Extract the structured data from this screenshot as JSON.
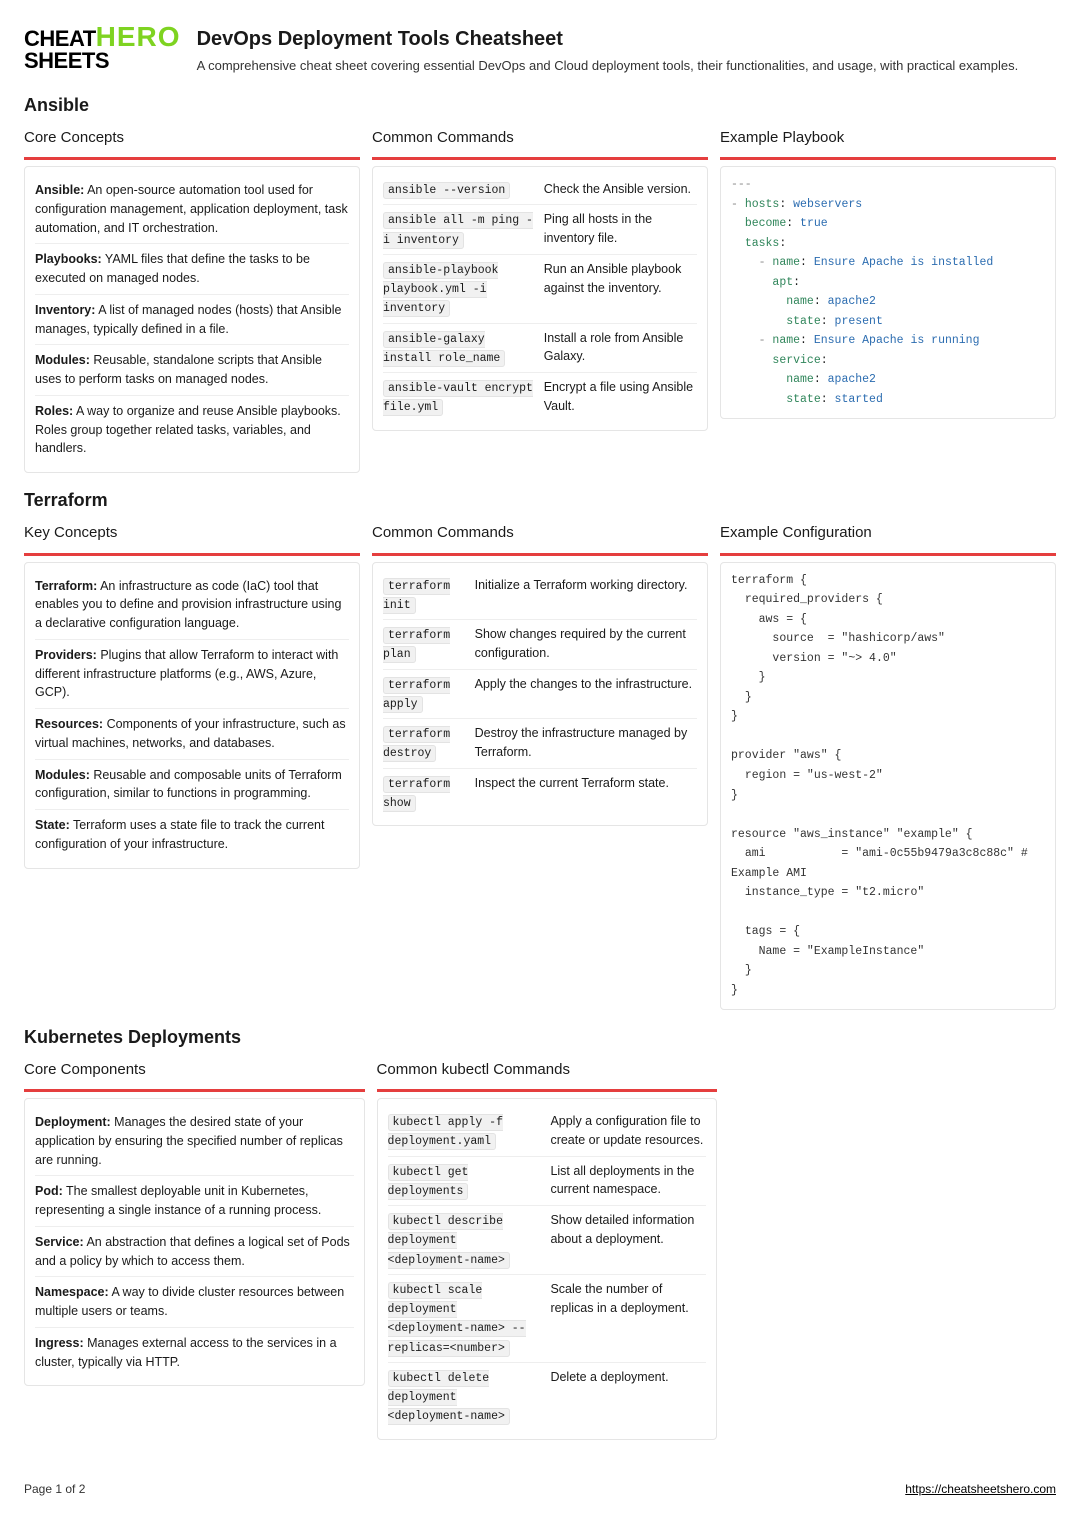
{
  "logo": {
    "line1a": "CHEAT",
    "line1b": "HERO",
    "line2": "SHEETS"
  },
  "title": "DevOps Deployment Tools Cheatsheet",
  "subtitle": "A comprehensive cheat sheet covering essential DevOps and Cloud deployment tools, their functionalities, and usage, with practical examples.",
  "sections": {
    "ansible": {
      "heading": "Ansible",
      "concepts_title": "Core Concepts",
      "concepts": [
        {
          "term": "Ansible:",
          "def": " An open-source automation tool used for configuration management, application deployment, task automation, and IT orchestration."
        },
        {
          "term": "Playbooks:",
          "def": " YAML files that define the tasks to be executed on managed nodes."
        },
        {
          "term": "Inventory:",
          "def": " A list of managed nodes (hosts) that Ansible manages, typically defined in a file."
        },
        {
          "term": "Modules:",
          "def": " Reusable, standalone scripts that Ansible uses to perform tasks on managed nodes."
        },
        {
          "term": "Roles:",
          "def": " A way to organize and reuse Ansible playbooks. Roles group together related tasks, variables, and handlers."
        }
      ],
      "commands_title": "Common Commands",
      "commands": [
        {
          "cmd": "ansible --version",
          "desc": "Check the Ansible version."
        },
        {
          "cmd": "ansible all -m ping -i inventory",
          "desc": "Ping all hosts in the inventory file."
        },
        {
          "cmd": "ansible-playbook playbook.yml -i inventory",
          "desc": "Run an Ansible playbook against the inventory."
        },
        {
          "cmd": "ansible-galaxy install role_name",
          "desc": "Install a role from Ansible Galaxy."
        },
        {
          "cmd": "ansible-vault encrypt file.yml",
          "desc": "Encrypt a file using Ansible Vault."
        }
      ],
      "example_title": "Example Playbook"
    },
    "terraform": {
      "heading": "Terraform",
      "concepts_title": "Key Concepts",
      "concepts": [
        {
          "term": "Terraform:",
          "def": " An infrastructure as code (IaC) tool that enables you to define and provision infrastructure using a declarative configuration language."
        },
        {
          "term": "Providers:",
          "def": " Plugins that allow Terraform to interact with different infrastructure platforms (e.g., AWS, Azure, GCP)."
        },
        {
          "term": "Resources:",
          "def": " Components of your infrastructure, such as virtual machines, networks, and databases."
        },
        {
          "term": "Modules:",
          "def": " Reusable and composable units of Terraform configuration, similar to functions in programming."
        },
        {
          "term": "State:",
          "def": " Terraform uses a state file to track the current configuration of your infrastructure."
        }
      ],
      "commands_title": "Common Commands",
      "commands": [
        {
          "cmd": "terraform init",
          "desc": "Initialize a Terraform working directory."
        },
        {
          "cmd": "terraform plan",
          "desc": "Show changes required by the current configuration."
        },
        {
          "cmd": "terraform apply",
          "desc": "Apply the changes to the infrastructure."
        },
        {
          "cmd": "terraform destroy",
          "desc": "Destroy the infrastructure managed by Terraform."
        },
        {
          "cmd": "terraform show",
          "desc": "Inspect the current Terraform state."
        }
      ],
      "example_title": "Example Configuration",
      "example_code": "terraform {\n  required_providers {\n    aws = {\n      source  = \"hashicorp/aws\"\n      version = \"~> 4.0\"\n    }\n  }\n}\n\nprovider \"aws\" {\n  region = \"us-west-2\"\n}\n\nresource \"aws_instance\" \"example\" {\n  ami           = \"ami-0c55b9479a3c8c88c\" # Example AMI\n  instance_type = \"t2.micro\"\n\n  tags = {\n    Name = \"ExampleInstance\"\n  }\n}"
    },
    "k8s": {
      "heading": "Kubernetes Deployments",
      "concepts_title": "Core Components",
      "concepts": [
        {
          "term": "Deployment:",
          "def": " Manages the desired state of your application by ensuring the specified number of replicas are running."
        },
        {
          "term": "Pod:",
          "def": " The smallest deployable unit in Kubernetes, representing a single instance of a running process."
        },
        {
          "term": "Service:",
          "def": " An abstraction that defines a logical set of Pods and a policy by which to access them."
        },
        {
          "term": "Namespace:",
          "def": " A way to divide cluster resources between multiple users or teams."
        },
        {
          "term": "Ingress:",
          "def": " Manages external access to the services in a cluster, typically via HTTP."
        }
      ],
      "commands_title": "Common kubectl Commands",
      "commands": [
        {
          "cmd": "kubectl apply -f deployment.yaml",
          "desc": "Apply a configuration file to create or update resources."
        },
        {
          "cmd": "kubectl get deployments",
          "desc": "List all deployments in the current namespace."
        },
        {
          "cmd": "kubectl describe deployment <deployment-name>",
          "desc": "Show detailed information about a deployment."
        },
        {
          "cmd": "kubectl scale deployment <deployment-name> --replicas=<number>",
          "desc": "Scale the number of replicas in a deployment."
        },
        {
          "cmd": "kubectl delete deployment <deployment-name>",
          "desc": "Delete a deployment."
        }
      ]
    }
  },
  "footer": {
    "page": "Page 1 of 2",
    "url": "https://cheatsheetshero.com"
  }
}
